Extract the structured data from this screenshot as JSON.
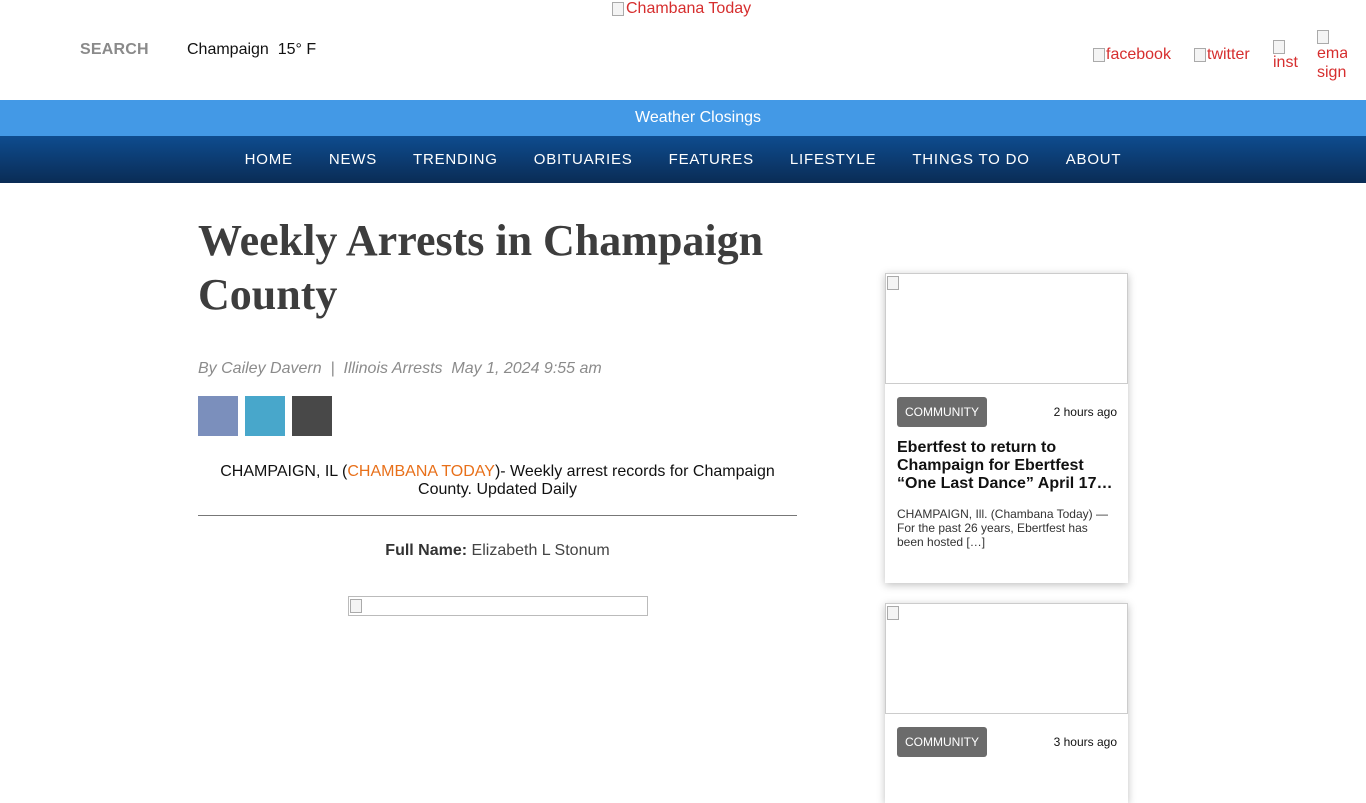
{
  "header": {
    "logo_alt": "Chambana Today",
    "search_label": "SEARCH",
    "weather": "Champaign  15° F",
    "social": {
      "facebook": "facebook",
      "twitter": "twitter",
      "instagram": "inst",
      "email_line1": "ema",
      "email_line2": "sign"
    }
  },
  "alert_bar": {
    "label": "Weather Closings"
  },
  "nav": {
    "items": [
      "HOME",
      "NEWS",
      "TRENDING",
      "OBITUARIES",
      "FEATURES",
      "LIFESTYLE",
      "THINGS TO DO",
      "ABOUT"
    ]
  },
  "article": {
    "title": "Weekly Arrests in Champaign County",
    "byline": "By Cailey Davern  |  Illinois Arrests  May 1, 2024 9:55 am",
    "share_colors": [
      "#7b8fbc",
      "#48a7cb",
      "#484848"
    ],
    "intro_prefix": "CHAMPAIGN, IL (",
    "intro_source": "CHAMBANA TODAY",
    "intro_suffix": ")- Weekly arrest records for Champaign County. Updated Daily",
    "full_name_label": "Full Name:",
    "full_name_value": " Elizabeth L Stonum"
  },
  "sidebar": {
    "cards": [
      {
        "category": "COMMUNITY",
        "time": "2 hours ago",
        "headline": "Ebertfest to return to Champaign for Ebertfest “One Last Dance” April 17…",
        "excerpt": "CHAMPAIGN, Ill. (Chambana Today) — For the past 26 years, Ebertfest has been hosted […]"
      },
      {
        "category": "COMMUNITY",
        "time": "3 hours ago"
      }
    ]
  },
  "colors": {
    "alert_bar": "#4399e6",
    "nav_top": "#0e4c8f",
    "nav_bottom": "#0a2c55",
    "link_red": "#d62e2e",
    "source_orange": "#e8701a"
  }
}
